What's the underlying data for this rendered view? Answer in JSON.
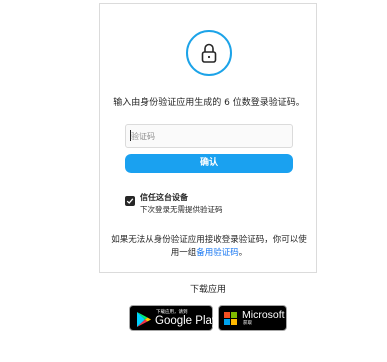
{
  "card": {
    "instruction": "输入由身份验证应用生成的 6 位数登录验证码。",
    "code_input": {
      "placeholder": "验证码",
      "value": ""
    },
    "confirm_label": "确认",
    "trust_device": {
      "checked": true,
      "title": "信任这台设备",
      "description": "下次登录无需提供验证码"
    },
    "fallback": {
      "text_before": "如果无法从身份验证应用接收登录验证码，你可以使用一组",
      "link_label": "备用验证码",
      "text_after": "。"
    }
  },
  "download": {
    "label": "下载应用",
    "google_play": {
      "small_text": "下载应用，请到",
      "big_text": "Google Play"
    },
    "microsoft": {
      "big_text": "Microsoft",
      "small_text": "获取"
    }
  },
  "colors": {
    "accent": "#1aa1f0",
    "link": "#1877f2",
    "lock_ring": "#1ca3e8",
    "border": "#dbdbdb"
  },
  "icons": {
    "lock": "lock-icon",
    "checkbox": "checkmark-icon",
    "google_play": "google-play-icon",
    "microsoft": "microsoft-logo-icon"
  }
}
